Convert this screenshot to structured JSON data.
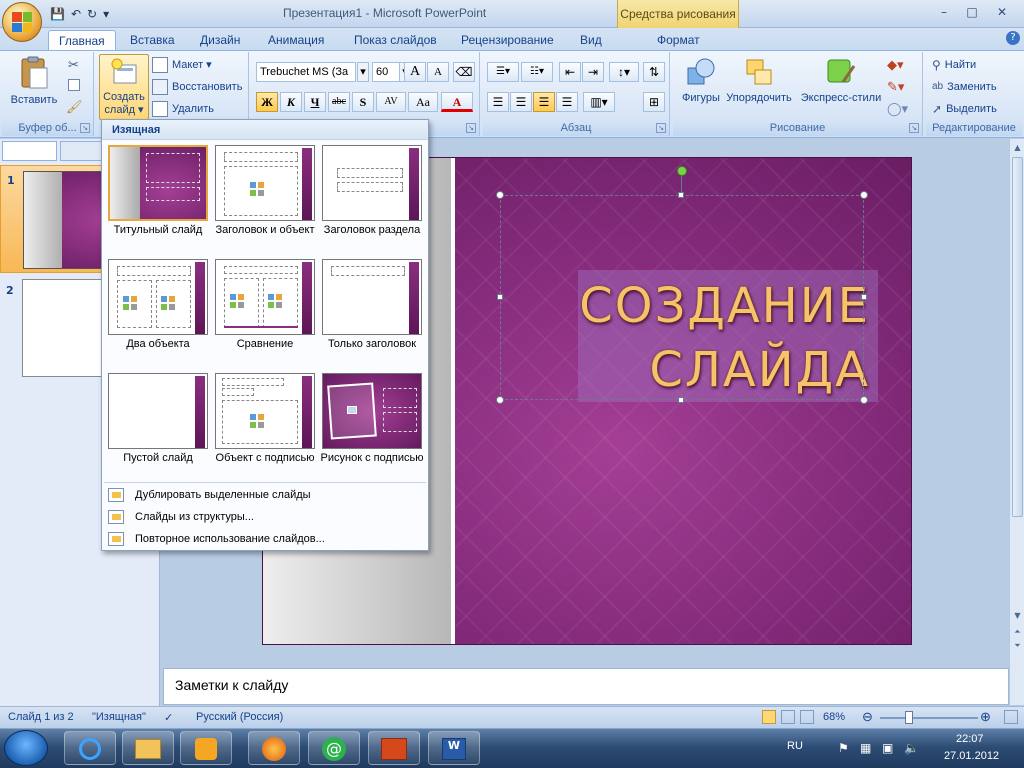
{
  "window": {
    "title": "Презентация1 - Microsoft PowerPoint",
    "context_tab_title": "Средства рисования",
    "minimize": "–",
    "maximize": "□",
    "close": "✕"
  },
  "quick_access": {
    "save": "💾",
    "undo": "↶",
    "redo": "↻",
    "customize": "▾"
  },
  "ribbon_tabs": [
    "Главная",
    "Вставка",
    "Дизайн",
    "Анимация",
    "Показ слайдов",
    "Рецензирование",
    "Вид",
    "Формат"
  ],
  "active_tab": "Главная",
  "ribbon": {
    "clipboard": {
      "label": "Буфер об...",
      "paste": "Вставить"
    },
    "slides": {
      "new_slide_line1": "Создать",
      "new_slide_line2": "слайд ▾",
      "layout": "Макет ▾",
      "reset": "Восстановить",
      "delete": "Удалить"
    },
    "font": {
      "name": "Trebuchet MS (За",
      "size": "60",
      "grow": "A",
      "shrink": "A",
      "bold": "Ж",
      "italic": "К",
      "underline": "Ч",
      "strike": "abc",
      "shadow": "S",
      "spacing": "AV",
      "case": "Aa",
      "color": "A"
    },
    "paragraph": {
      "label": "Абзац"
    },
    "drawing": {
      "label": "Рисование",
      "shapes": "Фигуры",
      "arrange": "Упорядочить",
      "quick_styles": "Экспресс-стили"
    },
    "editing": {
      "label": "Редактирование",
      "find": "Найти",
      "replace": "Заменить",
      "select": "Выделить"
    }
  },
  "layout_gallery": {
    "header": "Изящная",
    "layouts": [
      {
        "label": "Титульный слайд"
      },
      {
        "label": "Заголовок и объект"
      },
      {
        "label": "Заголовок раздела"
      },
      {
        "label": "Два объекта"
      },
      {
        "label": "Сравнение"
      },
      {
        "label": "Только заголовок"
      },
      {
        "label": "Пустой слайд"
      },
      {
        "label": "Объект с подписью"
      },
      {
        "label": "Рисунок с подписью"
      }
    ],
    "menu": [
      {
        "label": "Дублировать выделенные слайды"
      },
      {
        "label": "Слайды из структуры..."
      },
      {
        "label": "Повторное использование слайдов..."
      }
    ]
  },
  "thumbnails": [
    "1",
    "2"
  ],
  "slide": {
    "title_line1": "СОЗДАНИЕ",
    "title_line2": "СЛАЙДА"
  },
  "notes": {
    "placeholder": "Заметки к слайду"
  },
  "statusbar": {
    "slide_info": "Слайд 1 из 2",
    "theme": "\"Изящная\"",
    "language": "Русский (Россия)",
    "zoom": "68%"
  },
  "taskbar": {
    "lang": "RU",
    "time": "22:07",
    "date": "27.01.2012"
  },
  "colors": {
    "ribbon_text": "#15428b",
    "slide_purple": "#8a2e80",
    "title_gold": "#f6c36a",
    "selection_orange": "#e6a83a"
  }
}
